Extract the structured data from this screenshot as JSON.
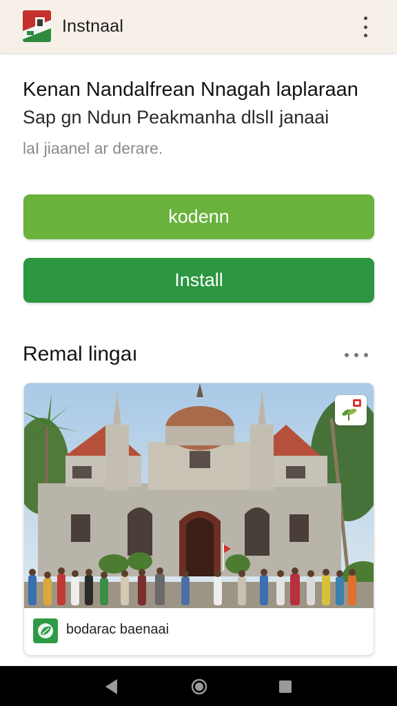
{
  "topbar": {
    "title": "Instnaal",
    "logo_icon": "flag-logo-icon",
    "menu_icon": "more-vertical-icon"
  },
  "header": {
    "headline": "Kenan Nandalfrean Nnagah laplaraan",
    "subline": "Sap gn Ndun Peakmanha dlslI janaai",
    "caption": "laI jiaanel ar derare."
  },
  "buttons": {
    "primary_label": "kodenn",
    "install_label": "Install"
  },
  "section": {
    "title": "Remal lingaı",
    "more_icon": "more-horizontal-icon"
  },
  "card": {
    "image_alt": "colonial-building-photo",
    "badge_icon": "map-pin-badge-icon",
    "footer_icon": "app-leaf-icon",
    "footer_label": "bodarac baenaai"
  },
  "navbar": {
    "back_icon": "back-triangle-icon",
    "home_icon": "home-circle-icon",
    "recents_icon": "recents-square-icon"
  },
  "colors": {
    "topbar_bg": "#f6f0e8",
    "primary_button": "#6ab23c",
    "install_button": "#2c9640",
    "nav_bg": "#000000"
  }
}
